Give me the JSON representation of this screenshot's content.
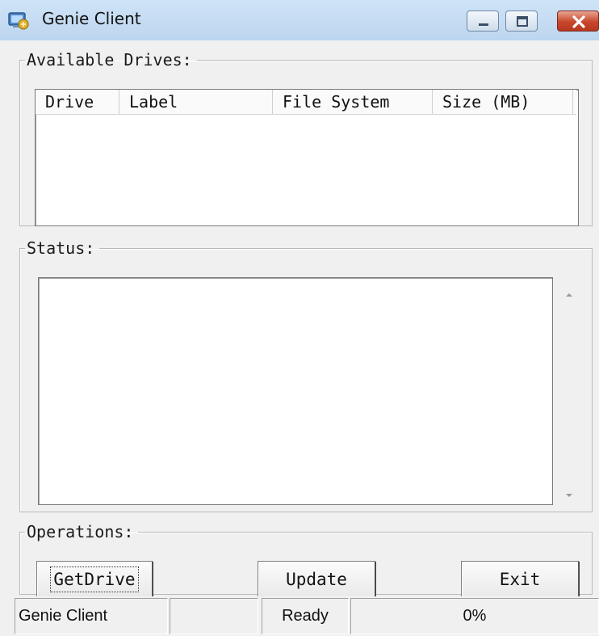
{
  "window": {
    "title": "Genie Client",
    "icon": "genie-app-icon",
    "controls": [
      "minimize-icon",
      "maximize-icon",
      "close-icon"
    ],
    "close_color": "#c8452b"
  },
  "drives_group": {
    "legend": "Available Drives:",
    "columns": [
      "Drive",
      "Label",
      "File System",
      "Size (MB)"
    ],
    "rows": []
  },
  "status_group": {
    "legend": "Status:",
    "text": ""
  },
  "operations_group": {
    "legend": "Operations:",
    "buttons": {
      "getdrive": "GetDrive",
      "update": "Update",
      "exit": "Exit"
    }
  },
  "statusbar": {
    "app": "Genie Client",
    "empty": "",
    "state": "Ready",
    "progress": "0%"
  }
}
